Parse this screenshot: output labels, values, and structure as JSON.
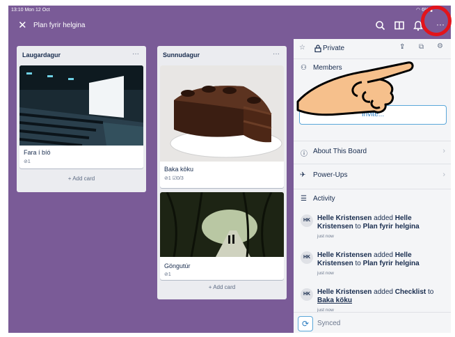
{
  "status": {
    "time": "13:10 Mon 12 Oct",
    "battery": "6%"
  },
  "header": {
    "board_title": "Plan fyrir helgina"
  },
  "lists": [
    {
      "title": "Laugardagur",
      "cards": [
        {
          "title": "Fara í bíó",
          "badges": "⊘1"
        }
      ],
      "add_card": "+ Add card"
    },
    {
      "title": "Sunnudagur",
      "cards": [
        {
          "title": "Baka köku",
          "badges": "⊘1 ☑0/3"
        },
        {
          "title": "Göngutúr",
          "badges": "⊘1"
        }
      ],
      "add_card": "+ Add card"
    }
  ],
  "panel": {
    "visibility": "Private",
    "members_label": "Members",
    "invite_label": "Invite...",
    "about_label": "About This Board",
    "powerups_label": "Power-Ups",
    "activity_label": "Activity",
    "activity": [
      {
        "initials": "HK",
        "actor": "Helle Kristensen",
        "verb": " added ",
        "object": "Helle Kristensen",
        "mid": " to ",
        "target": "Plan fyrir helgina",
        "time": "just now"
      },
      {
        "initials": "HK",
        "actor": "Helle Kristensen",
        "verb": " added ",
        "object": "Helle Kristensen",
        "mid": " to ",
        "target": "Plan fyrir helgina",
        "time": "just now"
      },
      {
        "initials": "HK",
        "actor": "Helle Kristensen",
        "verb": " added ",
        "object": "Checklist",
        "mid": " to ",
        "target": "Baka köku",
        "time": "just now"
      }
    ],
    "synced_label": "Synced"
  },
  "colors": {
    "board_bg": "#7a5b97",
    "highlight": "#e3141b",
    "link": "#2a7bc0"
  }
}
